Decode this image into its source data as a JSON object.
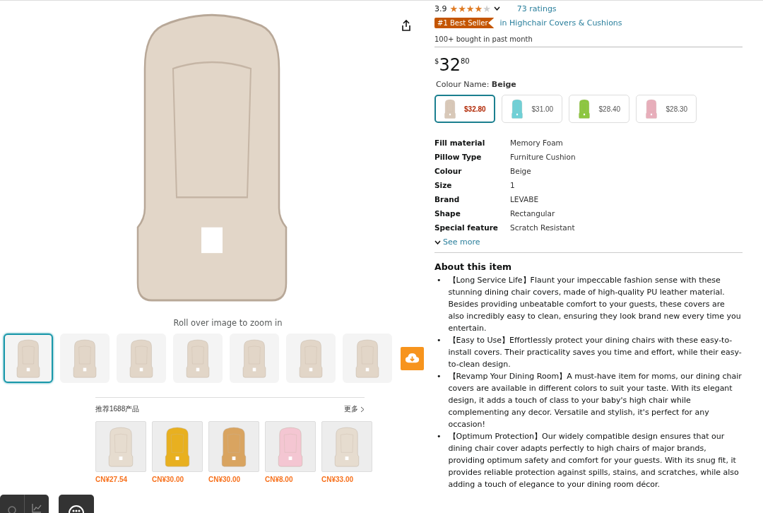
{
  "gallery": {
    "caption": "Roll over image to zoom in",
    "thumbnails": [
      {
        "selected": true
      },
      {
        "selected": false
      },
      {
        "selected": false
      },
      {
        "selected": false
      },
      {
        "selected": false
      },
      {
        "selected": false
      },
      {
        "selected": false
      }
    ]
  },
  "recommendations": {
    "title": "推荐1688产品",
    "more": "更多",
    "products": [
      {
        "price": "CN¥27.54",
        "color": "#e6dccf"
      },
      {
        "price": "CN¥30.00",
        "color": "#e8b020"
      },
      {
        "price": "CN¥30.00",
        "color": "#d9a460"
      },
      {
        "price": "CN¥8.00",
        "color": "#f4c6d2"
      },
      {
        "price": "CN¥33.00",
        "color": "#e6dccf"
      }
    ]
  },
  "product": {
    "rating": "3.9",
    "stars": 4,
    "ratings_count": "73 ratings",
    "badge": "#1 Best Seller",
    "category": "in Highchair Covers & Cushions",
    "bought": "100+ bought in past month",
    "price": {
      "currency": "$",
      "whole": "32",
      "fraction": "80"
    },
    "colour_label": "Colour Name:",
    "colour_value": "Beige",
    "swatches": [
      {
        "price": "$32.80",
        "color": "#d8c8b8",
        "selected": true
      },
      {
        "price": "$31.00",
        "color": "#6fd0d6",
        "selected": false
      },
      {
        "price": "$28.40",
        "color": "#8cc63f",
        "selected": false
      },
      {
        "price": "$28.30",
        "color": "#e8aebb",
        "selected": false
      }
    ],
    "specs": [
      {
        "label": "Fill material",
        "value": "Memory Foam"
      },
      {
        "label": "Pillow Type",
        "value": "Furniture Cushion"
      },
      {
        "label": "Colour",
        "value": "Beige"
      },
      {
        "label": "Size",
        "value": "1"
      },
      {
        "label": "Brand",
        "value": "LEVABE"
      },
      {
        "label": "Shape",
        "value": "Rectangular"
      },
      {
        "label": "Special feature",
        "value": "Scratch Resistant"
      }
    ],
    "see_more": "See more",
    "about_title": "About this item",
    "bullet_marker": "•",
    "bullets": [
      "【Long Service Life】Flaunt your impeccable fashion sense with these stunning dining chair covers, made of high-quality PU leather material. Besides providing unbeatable comfort to your guests, these covers are also incredibly easy to clean, ensuring they look brand new every time you entertain.",
      "【Easy to Use】Effortlessly protect your dining chairs with these easy-to-install covers. Their practicality saves you time and effort, while their easy-to-clean design.",
      "【Revamp Your Dining Room】A must-have item for moms, our dining chair covers are available in different colors to suit your taste. With its elegant design, it adds a touch of class to your baby's high chair while complementing any decor. Versatile and stylish, it's perfect for any occasion!",
      "【Optimum Protection】Our widely compatible design ensures that our dining chair cover adapts perfectly to high chairs of major brands, providing optimum safety and comfort for your guests. With its snug fit, it provides reliable protection against spills, stains, and scratches, while also adding a touch of elegance to your dining room décor."
    ]
  }
}
